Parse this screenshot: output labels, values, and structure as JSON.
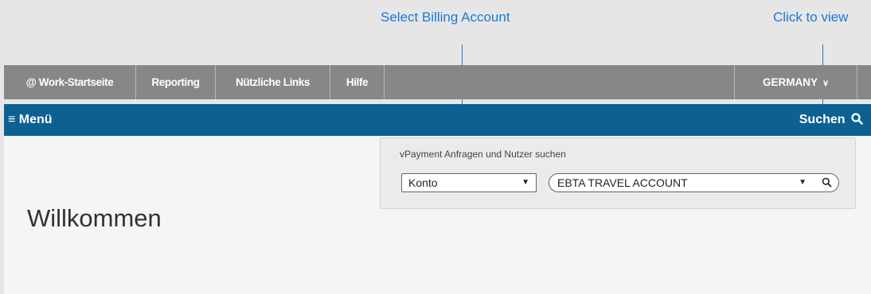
{
  "annotations": {
    "billing": "Select Billing Account",
    "view": "Click to view"
  },
  "nav": {
    "tabs": [
      "@ Work-Startseite",
      "Reporting",
      "Nützliche Links",
      "Hilfe"
    ],
    "country": "GERMANY",
    "country_icon": "chevron-down-icon"
  },
  "menu_bar": {
    "menu_icon": "hamburger-icon",
    "menu_label": "Menü",
    "search_label": "Suchen",
    "search_icon": "search-icon"
  },
  "main": {
    "welcome": "Willkommen"
  },
  "search_panel": {
    "title": "vPayment Anfragen und Nutzer suchen",
    "type_value": "Konto",
    "account_value": "EBTA TRAVEL ACCOUNT"
  },
  "colors": {
    "accent_blue": "#0d6192",
    "annotation_blue": "#1a7ad6",
    "nav_gray": "#878787"
  }
}
